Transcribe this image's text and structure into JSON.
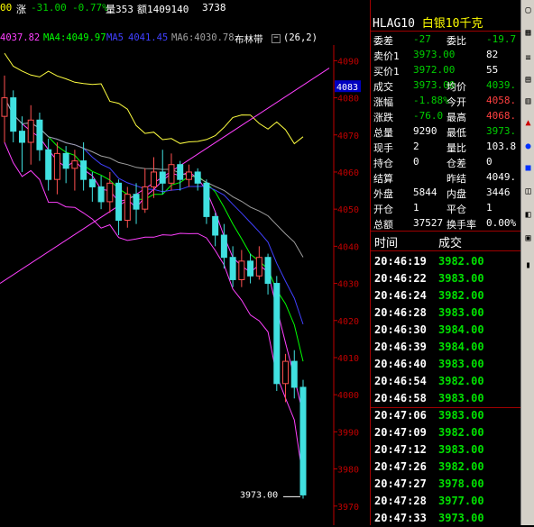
{
  "top_bar": {
    "last_digits": "00",
    "change_label": "涨",
    "change": "-31.00",
    "change_pct": "-0.77%",
    "volume_label": "量353",
    "amount_label": "额1409140",
    "last_value": "3738"
  },
  "ma_bar": {
    "ma3": "4037.82",
    "ma4_label": "MA4:4049.97",
    "ma5_label": "MA5",
    "ma5_value": "4041.45",
    "ma6_label": "MA6:4030.78",
    "boll_label": "布林带",
    "boll_params": "(26,2)",
    "colors": {
      "ma3": "#ff40ff",
      "ma4": "#00ff00",
      "ma5": "#4040ff",
      "ma6": "#a0a0a0"
    }
  },
  "chart_data": {
    "type": "candlestick",
    "y_ticks": [
      "4090",
      "4080",
      "4070",
      "4060",
      "4050",
      "4040",
      "4030",
      "4020",
      "4010",
      "4000",
      "3990",
      "3980",
      "3970"
    ],
    "ylim": [
      3968,
      4093
    ],
    "current_price_tag": "4083",
    "last_price_label": "3973.00",
    "candles": [
      {
        "o": 4075,
        "c": 4080,
        "h": 4086,
        "l": 4068
      },
      {
        "o": 4080,
        "c": 4071,
        "h": 4082,
        "l": 4068
      },
      {
        "o": 4071,
        "c": 4068,
        "h": 4075,
        "l": 4060
      },
      {
        "o": 4068,
        "c": 4074,
        "h": 4078,
        "l": 4062
      },
      {
        "o": 4074,
        "c": 4066,
        "h": 4076,
        "l": 4063
      },
      {
        "o": 4066,
        "c": 4058,
        "h": 4069,
        "l": 4055
      },
      {
        "o": 4058,
        "c": 4065,
        "h": 4068,
        "l": 4054
      },
      {
        "o": 4065,
        "c": 4061,
        "h": 4067,
        "l": 4057
      },
      {
        "o": 4061,
        "c": 4063,
        "h": 4066,
        "l": 4055
      },
      {
        "o": 4063,
        "c": 4058,
        "h": 4068,
        "l": 4055
      },
      {
        "o": 4058,
        "c": 4056,
        "h": 4060,
        "l": 4052
      },
      {
        "o": 4056,
        "c": 4052,
        "h": 4059,
        "l": 4050
      },
      {
        "o": 4052,
        "c": 4057,
        "h": 4060,
        "l": 4049
      },
      {
        "o": 4057,
        "c": 4047,
        "h": 4058,
        "l": 4043
      },
      {
        "o": 4047,
        "c": 4054,
        "h": 4056,
        "l": 4045
      },
      {
        "o": 4054,
        "c": 4050,
        "h": 4057,
        "l": 4046
      },
      {
        "o": 4050,
        "c": 4056,
        "h": 4061,
        "l": 4049
      },
      {
        "o": 4056,
        "c": 4060,
        "h": 4064,
        "l": 4053
      },
      {
        "o": 4060,
        "c": 4057,
        "h": 4066,
        "l": 4054
      },
      {
        "o": 4057,
        "c": 4062,
        "h": 4065,
        "l": 4055
      },
      {
        "o": 4062,
        "c": 4058,
        "h": 4063,
        "l": 4055
      },
      {
        "o": 4058,
        "c": 4060,
        "h": 4062,
        "l": 4056
      },
      {
        "o": 4060,
        "c": 4057,
        "h": 4061,
        "l": 4055
      },
      {
        "o": 4057,
        "c": 4048,
        "h": 4058,
        "l": 4046
      },
      {
        "o": 4048,
        "c": 4043,
        "h": 4049,
        "l": 4040
      },
      {
        "o": 4043,
        "c": 4037,
        "h": 4046,
        "l": 4034
      },
      {
        "o": 4037,
        "c": 4031,
        "h": 4040,
        "l": 4029
      },
      {
        "o": 4031,
        "c": 4036,
        "h": 4039,
        "l": 4029
      },
      {
        "o": 4036,
        "c": 4032,
        "h": 4038,
        "l": 4030
      },
      {
        "o": 4032,
        "c": 4037,
        "h": 4040,
        "l": 4031
      },
      {
        "o": 4037,
        "c": 4030,
        "h": 4038,
        "l": 4027
      },
      {
        "o": 4030,
        "c": 4003,
        "h": 4032,
        "l": 4001
      },
      {
        "o": 4003,
        "c": 4009,
        "h": 4011,
        "l": 3998
      },
      {
        "o": 4009,
        "c": 4002,
        "h": 4012,
        "l": 3999
      },
      {
        "o": 4002,
        "c": 3973,
        "h": 4004,
        "l": 3972
      }
    ]
  },
  "quote_panel": {
    "code": "HLAG10",
    "name": "白银10千克",
    "rows": [
      {
        "l1": "委差",
        "v1": "-27",
        "l2": "委比",
        "v2": "-19.7",
        "c1": "grn",
        "c2": "grn"
      },
      {
        "l1": "卖价1",
        "v1": "3973.00",
        "l2": "",
        "v2": "82",
        "c1": "grn",
        "c2": "wht"
      },
      {
        "l1": "买价1",
        "v1": "3972.00",
        "l2": "",
        "v2": "55",
        "c1": "grn",
        "c2": "wht"
      },
      {
        "l1": "成交",
        "v1": "3973.00",
        "l2": "均价",
        "v2": "4039.",
        "c1": "grn",
        "c2": "grn"
      },
      {
        "l1": "涨幅",
        "v1": "-1.88%",
        "l2": "今开",
        "v2": "4058.",
        "c1": "grn",
        "c2": "red"
      },
      {
        "l1": "涨跌",
        "v1": "-76.0",
        "l2": "最高",
        "v2": "4068.",
        "c1": "grn",
        "c2": "red"
      },
      {
        "l1": "总量",
        "v1": "9290",
        "l2": "最低",
        "v2": "3973.",
        "c1": "wht",
        "c2": "grn"
      },
      {
        "l1": "现手",
        "v1": "2",
        "l2": "量比",
        "v2": "103.8",
        "c1": "wht",
        "c2": "wht"
      },
      {
        "l1": "持仓",
        "v1": "0",
        "l2": "仓差",
        "v2": "0",
        "c1": "wht",
        "c2": "wht"
      },
      {
        "l1": "结算",
        "v1": "",
        "l2": "昨结",
        "v2": "4049.",
        "c1": "wht",
        "c2": "wht"
      },
      {
        "l1": "外盘",
        "v1": "5844",
        "l2": "内盘",
        "v2": "3446",
        "c1": "wht",
        "c2": "wht"
      },
      {
        "l1": "开仓",
        "v1": "1",
        "l2": "平仓",
        "v2": "1",
        "c1": "wht",
        "c2": "wht"
      },
      {
        "l1": "总额",
        "v1": "37527",
        "l2": "换手率",
        "v2": "0.00%",
        "c1": "wht",
        "c2": "wht"
      }
    ]
  },
  "trades": {
    "col_time": "时间",
    "col_trade": "成交",
    "rows": [
      {
        "t": "20:46:19",
        "p": "3982.00"
      },
      {
        "t": "20:46:22",
        "p": "3983.00"
      },
      {
        "t": "20:46:24",
        "p": "3982.00"
      },
      {
        "t": "20:46:28",
        "p": "3983.00"
      },
      {
        "t": "20:46:30",
        "p": "3984.00"
      },
      {
        "t": "20:46:39",
        "p": "3984.00"
      },
      {
        "t": "20:46:40",
        "p": "3983.00"
      },
      {
        "t": "20:46:54",
        "p": "3982.00"
      },
      {
        "t": "20:46:58",
        "p": "3983.00"
      },
      {
        "t": "20:47:06",
        "p": "3983.00"
      },
      {
        "t": "20:47:09",
        "p": "3982.00"
      },
      {
        "t": "20:47:12",
        "p": "3983.00"
      },
      {
        "t": "20:47:26",
        "p": "3982.00"
      },
      {
        "t": "20:47:27",
        "p": "3978.00"
      },
      {
        "t": "20:47:28",
        "p": "3977.00"
      },
      {
        "t": "20:47:33",
        "p": "3973.00"
      }
    ]
  }
}
